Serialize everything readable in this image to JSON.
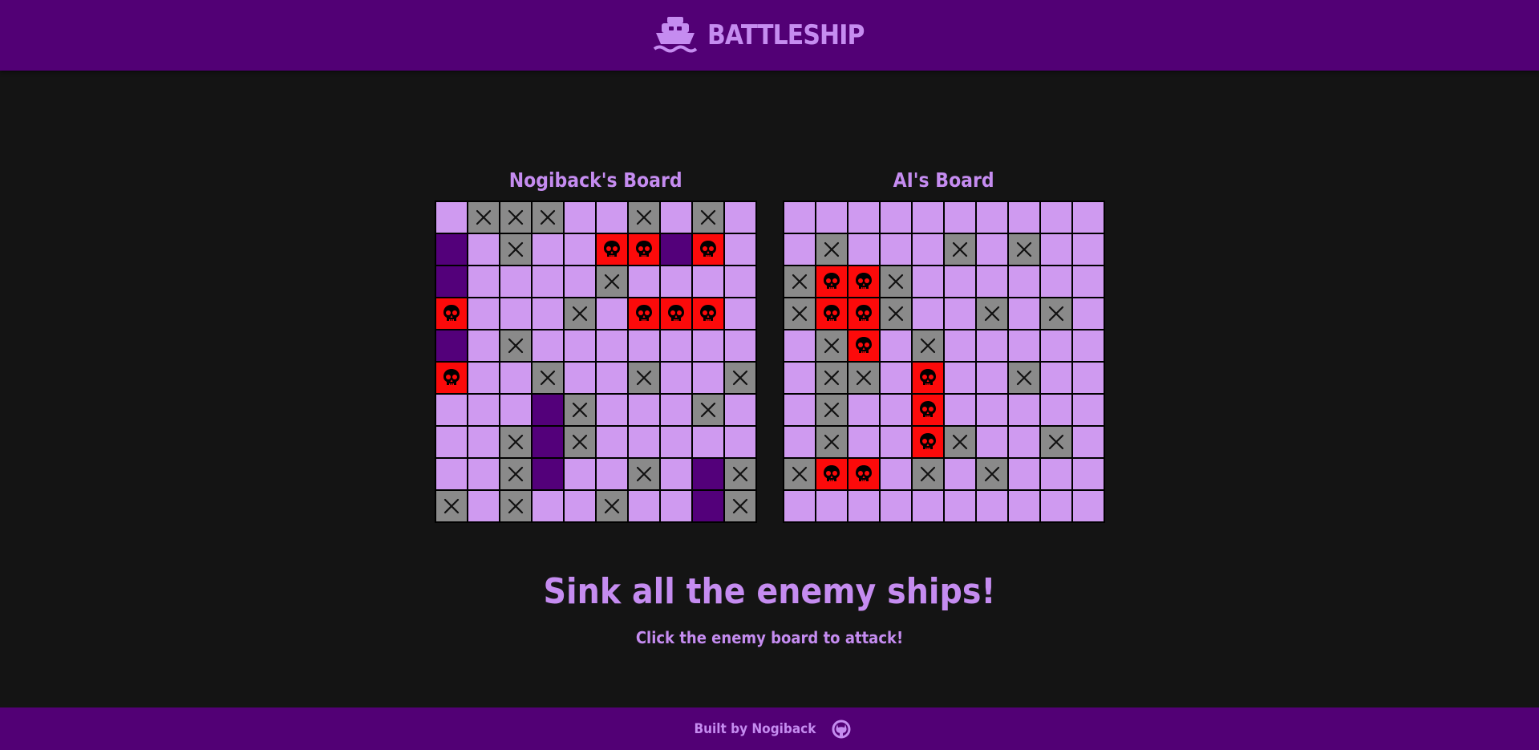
{
  "header": {
    "title": "BATTLESHIP",
    "logo_icon": "ship-icon"
  },
  "player_board": {
    "title": "Nogiback's Board",
    "grid": [
      "EMMMEEMEME",
      "SEMEEHHSHE",
      "SEEEEMEEEE",
      "HEEEMEHHHE",
      "SEMEEEEEEE",
      "HEEMEEMEEM",
      "EEESMEEEME",
      "EEMSMEEEEE",
      "EEMSEEMESM",
      "MEMEEMEESM"
    ]
  },
  "enemy_board": {
    "title": "AI's Board",
    "grid": [
      "EEEEEEEEEE",
      "EMEEEMEMEE",
      "MHHMEEEEEE",
      "MHHMEEMEME",
      "EMHEMEEEEE",
      "EMMEHEEMEE",
      "EMEEHEEEEE",
      "EMEEHMEEME",
      "MHHEMEMEEE",
      "EEEEEEEEEE"
    ]
  },
  "legend": {
    "E": "empty",
    "S": "ship",
    "M": "miss",
    "H": "hit"
  },
  "colors": {
    "header_bg": "#520075",
    "accent": "#c58cf0",
    "cell_empty": "#cf9af0",
    "cell_ship": "#53007a",
    "cell_miss": "#8a8a8a",
    "cell_hit": "#fc0a0a",
    "page_bg": "#141414"
  },
  "status": {
    "headline": "Sink all the enemy ships!",
    "instruction": "Click the enemy board to attack!"
  },
  "footer": {
    "text": "Built by Nogiback",
    "icon": "github-icon"
  }
}
